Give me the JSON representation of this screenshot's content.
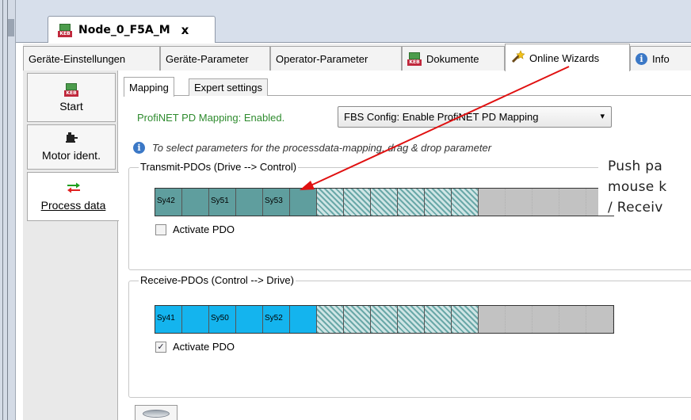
{
  "document_tab": {
    "title": "Node_0_F5A_M",
    "close": "x"
  },
  "property_tabs": [
    {
      "label": "Geräte-Einstellungen",
      "active": false,
      "icon": ""
    },
    {
      "label": "Geräte-Parameter",
      "active": false,
      "icon": ""
    },
    {
      "label": "Operator-Parameter",
      "active": false,
      "icon": ""
    },
    {
      "label": "Dokumente",
      "active": false,
      "icon": "keb-icon"
    },
    {
      "label": "Online Wizards",
      "active": true,
      "icon": "wand-icon"
    },
    {
      "label": "Info",
      "active": false,
      "icon": "info-icon"
    }
  ],
  "left_nav": [
    {
      "label": "Start",
      "icon": "keb-icon",
      "active": false
    },
    {
      "label": "Motor ident.",
      "icon": "motor-icon",
      "active": false
    },
    {
      "label": "Process data",
      "icon": "exchange-arrows-icon",
      "active": true
    }
  ],
  "sub_tabs": [
    {
      "label": "Mapping",
      "active": true
    },
    {
      "label": "Expert settings",
      "active": false
    }
  ],
  "status_text": "ProfiNET PD Mapping: Enabled.",
  "fbs_combo": {
    "value": "FBS Config: Enable ProfiNET PD Mapping",
    "arrow": "▾"
  },
  "info_text": "To select parameters for the processdata-mapping, drag & drop parameter",
  "transmit": {
    "legend": "Transmit-PDOs  (Drive --> Control)",
    "slots": [
      "Sy42",
      "",
      "Sy51",
      "",
      "Sy53",
      ""
    ],
    "activate_label": "Activate PDO",
    "activate_checked": false
  },
  "receive": {
    "legend": "Receive-PDOs  (Control --> Drive)",
    "slots": [
      "Sy41",
      "",
      "Sy50",
      "",
      "Sy52",
      ""
    ],
    "activate_label": "Activate PDO",
    "activate_checked": true,
    "check_mark": "✓"
  },
  "callout": {
    "line1": "Push pa",
    "line2": "mouse k",
    "line3": "/ Receiv"
  },
  "colors": {
    "transmit_slot": "#5f9e9e",
    "receive_slot": "#14b4ee",
    "status_green": "#2e8b2e",
    "arrow_red": "#e01010"
  }
}
